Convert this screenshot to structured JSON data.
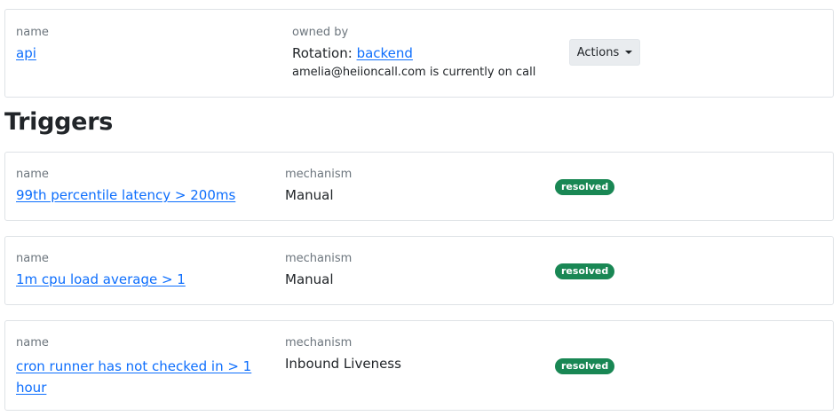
{
  "service": {
    "name_label": "name",
    "name_value": "api",
    "owned_by_label": "owned by",
    "rotation_prefix": "Rotation: ",
    "rotation_name": "backend",
    "on_call_text": "amelia@heiioncall.com is currently on call",
    "actions_label": "Actions"
  },
  "triggers": {
    "heading": "Triggers",
    "items": [
      {
        "name_label": "name",
        "name": "99th percentile latency > 200ms",
        "mechanism_label": "mechanism",
        "mechanism": "Manual",
        "status": "resolved"
      },
      {
        "name_label": "name",
        "name": "1m cpu load average > 1",
        "mechanism_label": "mechanism",
        "mechanism": "Manual",
        "status": "resolved"
      },
      {
        "name_label": "name",
        "name_line1": "cron runner has not checked in > 1",
        "name_line2": "hour",
        "mechanism_label": "mechanism",
        "mechanism": "Inbound Liveness",
        "status": "resolved"
      }
    ]
  },
  "colors": {
    "link": "#0d6efd",
    "badge_success": "#198754",
    "border": "#dee2e6",
    "muted": "#6c757d"
  }
}
